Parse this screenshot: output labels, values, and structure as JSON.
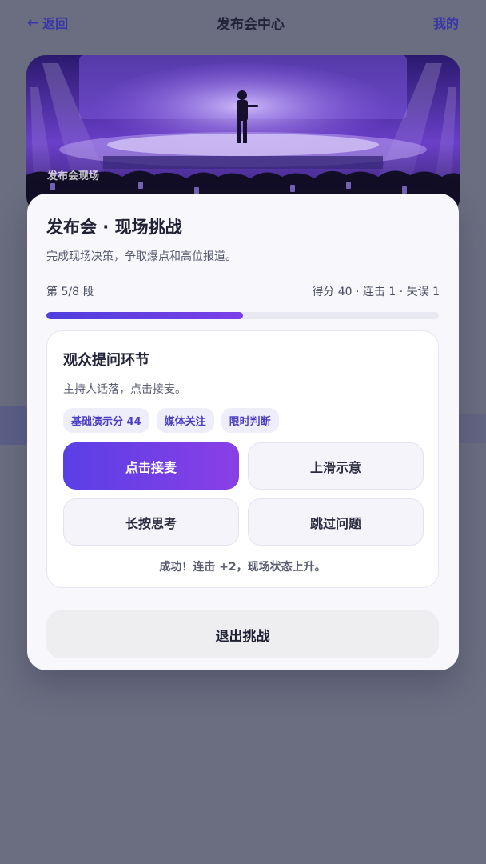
{
  "header": {
    "back_label": "返回",
    "title": "发布会中心",
    "mine_label": "我的"
  },
  "banner": {
    "caption": "发布会现场"
  },
  "modal": {
    "title": "发布会 · 现场挑战",
    "subtitle": "完成现场决策，争取爆点和高位报道。",
    "progress": {
      "segment_label": "第 5/8 段",
      "stats_label": "得分 40 · 连击 1 · 失误 1",
      "fraction": 0.5
    },
    "question": {
      "title": "观众提问环节",
      "subtitle": "主持人话落，点击接麦。",
      "tags": [
        "基础演示分 44",
        "媒体关注",
        "限时判断"
      ],
      "options": [
        "点击接麦",
        "上滑示意",
        "长按思考",
        "跳过问题"
      ],
      "feedback": "成功！连击 +2，现场状态上升。"
    },
    "exit_label": "退出挑战"
  },
  "colors": {
    "accent": "#5a3fe6",
    "accent_end": "#8a3fe6",
    "link": "#3a37a8",
    "backdrop": "#6b6e80"
  }
}
